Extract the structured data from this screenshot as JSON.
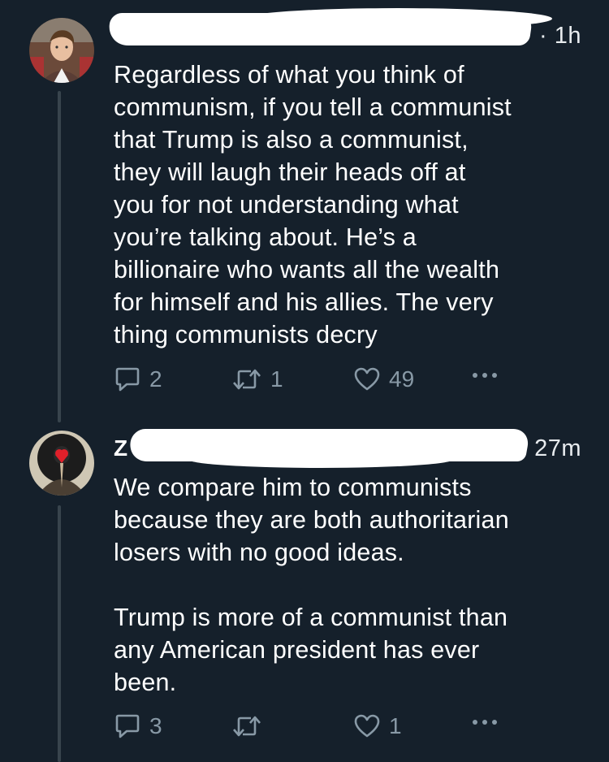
{
  "tweets": [
    {
      "author_visible": "",
      "time": "· 1h",
      "text": "Regardless of what you think of\ncommunism, if you tell a communist\nthat Trump is also a communist,\nthey will laugh their heads off at\nyou for not understanding what\nyou’re talking about. He’s a\nbillionaire who wants all the wealth\nfor himself and his allies. The very\nthing communists decry",
      "replies": "2",
      "retweets": "1",
      "likes": "49"
    },
    {
      "author_visible": "Z",
      "time": "27m",
      "text": "We compare him to communists\nbecause they are both authoritarian\nlosers with no good ideas.\n\nTrump is more of a communist than\nany American president has ever\nbeen.",
      "replies": "3",
      "retweets": "",
      "likes": "1"
    }
  ],
  "colors": {
    "background": "#15202b",
    "text": "#ffffff",
    "secondary": "#8899a6",
    "thread_line": "#38444d"
  },
  "icons": [
    "reply-icon",
    "retweet-icon",
    "like-icon",
    "more-icon"
  ]
}
